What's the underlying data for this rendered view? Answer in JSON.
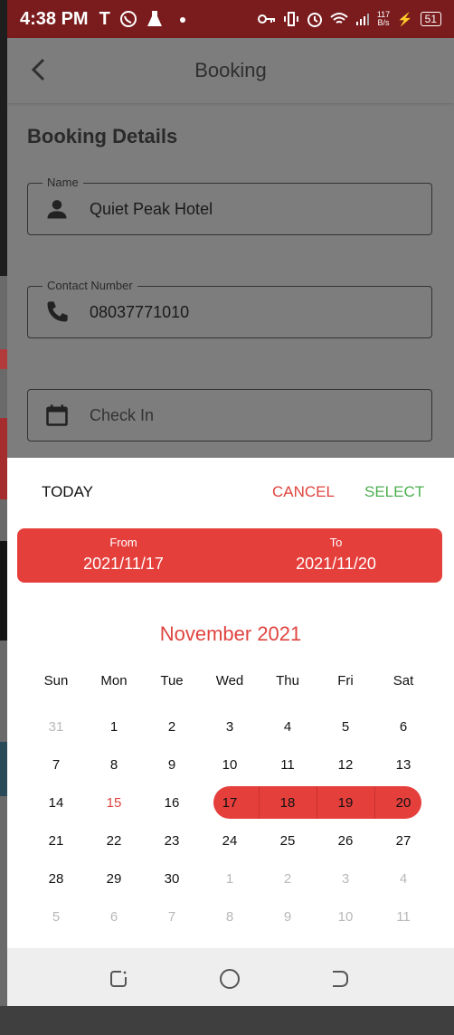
{
  "statusbar": {
    "time": "4:38 PM",
    "speed": "117\nB/s",
    "battery": "51"
  },
  "appbar": {
    "title": "Booking"
  },
  "section": {
    "title": "Booking Details"
  },
  "fields": {
    "name": {
      "legend": "Name",
      "value": "Quiet Peak Hotel"
    },
    "contact": {
      "legend": "Contact Number",
      "value": "08037771010"
    },
    "checkin": {
      "placeholder": "Check In"
    }
  },
  "dialog": {
    "today": "TODAY",
    "cancel": "CANCEL",
    "select": "SELECT",
    "from_label": "From",
    "from_value": "2021/11/17",
    "to_label": "To",
    "to_value": "2021/11/20",
    "month": "November 2021",
    "weekdays": [
      "Sun",
      "Mon",
      "Tue",
      "Wed",
      "Thu",
      "Fri",
      "Sat"
    ],
    "weeks": [
      [
        "31",
        "1",
        "2",
        "3",
        "4",
        "5",
        "6"
      ],
      [
        "7",
        "8",
        "9",
        "10",
        "11",
        "12",
        "13"
      ],
      [
        "14",
        "15",
        "16",
        "17",
        "18",
        "19",
        "20"
      ],
      [
        "21",
        "22",
        "23",
        "24",
        "25",
        "26",
        "27"
      ],
      [
        "28",
        "29",
        "30",
        "1",
        "2",
        "3",
        "4"
      ],
      [
        "5",
        "6",
        "7",
        "8",
        "9",
        "10",
        "11"
      ]
    ]
  },
  "colors": {
    "accent": "#e53f3c",
    "select": "#4caf50",
    "statusbar": "#7a1c1e"
  }
}
